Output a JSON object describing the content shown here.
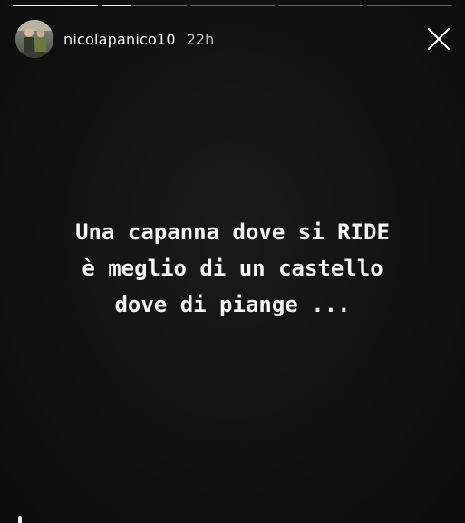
{
  "story": {
    "progress_segments": [
      1.0,
      0.35,
      0,
      0,
      0
    ],
    "user": {
      "username": "nicolapanico10",
      "time_ago": "22h",
      "avatar_icon": "profile-photo"
    },
    "close_icon": "close-x-icon",
    "caption_lines": [
      "Una capanna dove si RIDE",
      "è meglio di un castello",
      "dove di piange ..."
    ]
  }
}
